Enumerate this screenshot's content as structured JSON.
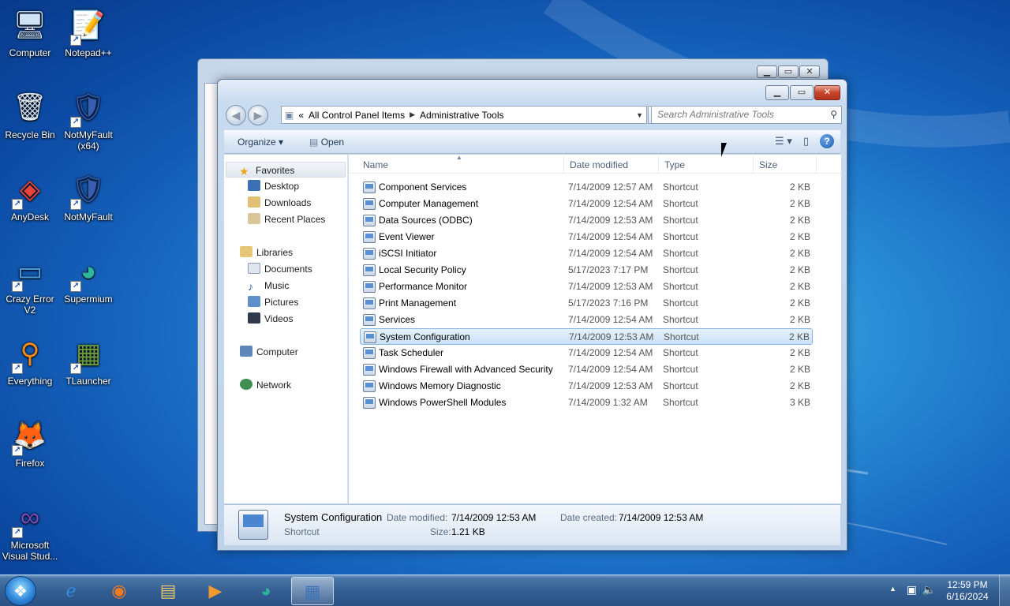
{
  "desktop": {
    "icons": [
      {
        "label": "Computer",
        "glyph": "🖥"
      },
      {
        "label": "Notepad++",
        "glyph": "📝"
      },
      {
        "label": "Recycle Bin",
        "glyph": "🗑"
      },
      {
        "label": "NotMyFault (x64)",
        "glyph": "🛡"
      },
      {
        "label": "AnyDesk",
        "glyph": "◈"
      },
      {
        "label": "NotMyFault",
        "glyph": "🛡"
      },
      {
        "label": "Crazy Error V2",
        "glyph": "▭"
      },
      {
        "label": "Supermium",
        "glyph": "◕"
      },
      {
        "label": "Everything",
        "glyph": "⚲"
      },
      {
        "label": "TLauncher",
        "glyph": "▦"
      },
      {
        "label": "Firefox",
        "glyph": "🦊"
      },
      {
        "label": "Microsoft Visual Stud...",
        "glyph": "∞"
      }
    ]
  },
  "window": {
    "address": {
      "chevron": "«",
      "segments": [
        "All Control Panel Items",
        "Administrative Tools"
      ]
    },
    "search_placeholder": "Search Administrative Tools",
    "toolbar": {
      "organize": "Organize ▾",
      "open": "Open"
    },
    "nav": {
      "favorites": "Favorites",
      "desktop": "Desktop",
      "downloads": "Downloads",
      "recent": "Recent Places",
      "libraries": "Libraries",
      "documents": "Documents",
      "music": "Music",
      "pictures": "Pictures",
      "videos": "Videos",
      "computer": "Computer",
      "network": "Network"
    },
    "columns": {
      "name": "Name",
      "date": "Date modified",
      "type": "Type",
      "size": "Size"
    },
    "files": [
      {
        "name": "Component Services",
        "date": "7/14/2009 12:57 AM",
        "type": "Shortcut",
        "size": "2 KB"
      },
      {
        "name": "Computer Management",
        "date": "7/14/2009 12:54 AM",
        "type": "Shortcut",
        "size": "2 KB"
      },
      {
        "name": "Data Sources (ODBC)",
        "date": "7/14/2009 12:53 AM",
        "type": "Shortcut",
        "size": "2 KB"
      },
      {
        "name": "Event Viewer",
        "date": "7/14/2009 12:54 AM",
        "type": "Shortcut",
        "size": "2 KB"
      },
      {
        "name": "iSCSI Initiator",
        "date": "7/14/2009 12:54 AM",
        "type": "Shortcut",
        "size": "2 KB"
      },
      {
        "name": "Local Security Policy",
        "date": "5/17/2023 7:17 PM",
        "type": "Shortcut",
        "size": "2 KB"
      },
      {
        "name": "Performance Monitor",
        "date": "7/14/2009 12:53 AM",
        "type": "Shortcut",
        "size": "2 KB"
      },
      {
        "name": "Print Management",
        "date": "5/17/2023 7:16 PM",
        "type": "Shortcut",
        "size": "2 KB"
      },
      {
        "name": "Services",
        "date": "7/14/2009 12:54 AM",
        "type": "Shortcut",
        "size": "2 KB"
      },
      {
        "name": "System Configuration",
        "date": "7/14/2009 12:53 AM",
        "type": "Shortcut",
        "size": "2 KB"
      },
      {
        "name": "Task Scheduler",
        "date": "7/14/2009 12:54 AM",
        "type": "Shortcut",
        "size": "2 KB"
      },
      {
        "name": "Windows Firewall with Advanced Security",
        "date": "7/14/2009 12:54 AM",
        "type": "Shortcut",
        "size": "2 KB"
      },
      {
        "name": "Windows Memory Diagnostic",
        "date": "7/14/2009 12:53 AM",
        "type": "Shortcut",
        "size": "2 KB"
      },
      {
        "name": "Windows PowerShell Modules",
        "date": "7/14/2009 1:32 AM",
        "type": "Shortcut",
        "size": "3 KB"
      }
    ],
    "selected_index": 9,
    "details": {
      "name": "System Configuration",
      "kind": "Shortcut",
      "modified_label": "Date modified:",
      "modified": "7/14/2009 12:53 AM",
      "created_label": "Date created:",
      "created": "7/14/2009 12:53 AM",
      "size_label": "Size:",
      "size": "1.21 KB"
    }
  },
  "taskbar": {
    "time": "12:59 PM",
    "date": "6/16/2024",
    "apps": [
      "internet-explorer",
      "firefox",
      "file-explorer",
      "media-player",
      "supermium",
      "control-panel"
    ]
  }
}
